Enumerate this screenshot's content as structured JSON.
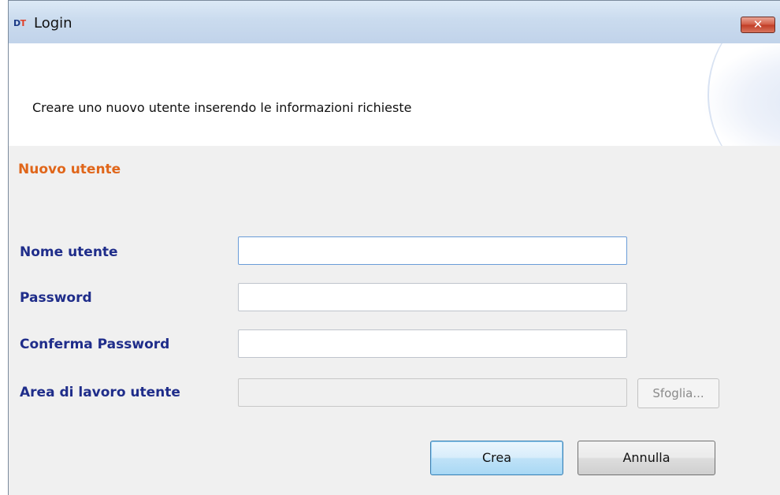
{
  "window": {
    "title": "Login",
    "app_icon_text_d": "D",
    "app_icon_text_t": "T",
    "close_glyph": "✕"
  },
  "header": {
    "instruction": "Creare uno nuovo utente inserendo le informazioni richieste"
  },
  "section": {
    "title": "Nuovo utente"
  },
  "form": {
    "username_label": "Nome utente",
    "username_value": "",
    "password_label": "Password",
    "password_value": "",
    "confirm_password_label": "Conferma Password",
    "confirm_password_value": "",
    "workspace_label": "Area di lavoro utente",
    "workspace_value": "",
    "browse_label": "Sfoglia..."
  },
  "buttons": {
    "create_label": "Crea",
    "cancel_label": "Annulla"
  },
  "colors": {
    "section_title": "#e0661a",
    "field_label": "#1f2d8a"
  }
}
